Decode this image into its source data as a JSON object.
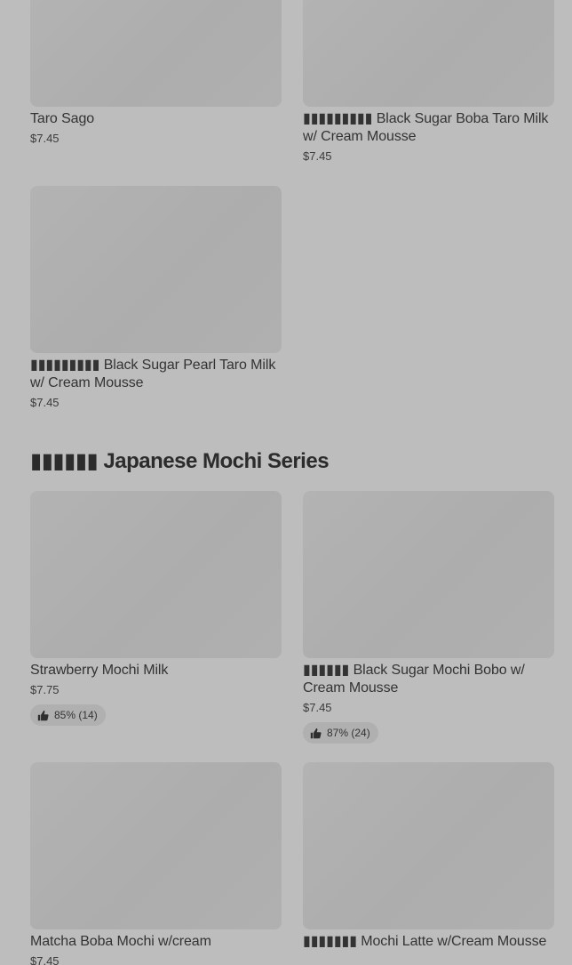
{
  "top_items": [
    {
      "name": "Taro Sago",
      "price": "$7.45"
    },
    {
      "name": "▮▮▮▮▮▮▮▮▮ Black Sugar Boba Taro Milk w/ Cream Mousse",
      "price": "$7.45"
    },
    {
      "name": "▮▮▮▮▮▮▮▮▮ Black Sugar Pearl Taro Milk w/ Cream Mousse",
      "price": "$7.45"
    }
  ],
  "section": {
    "title": "▮▮▮▮▮▮ Japanese Mochi Series",
    "items": [
      {
        "name": "Strawberry Mochi Milk",
        "price": "$7.75",
        "rating": "85% (14)"
      },
      {
        "name": "▮▮▮▮▮▮ Black Sugar Mochi Bobo w/ Cream Mousse",
        "price": "$7.45",
        "rating": "87% (24)"
      },
      {
        "name": "Matcha Boba Mochi w/cream",
        "price": "$7.45"
      },
      {
        "name": "▮▮▮▮▮▮▮ Mochi Latte w/Cream Mousse",
        "price": ""
      }
    ]
  },
  "icons": {
    "rating": "thumbs-up-icon"
  }
}
